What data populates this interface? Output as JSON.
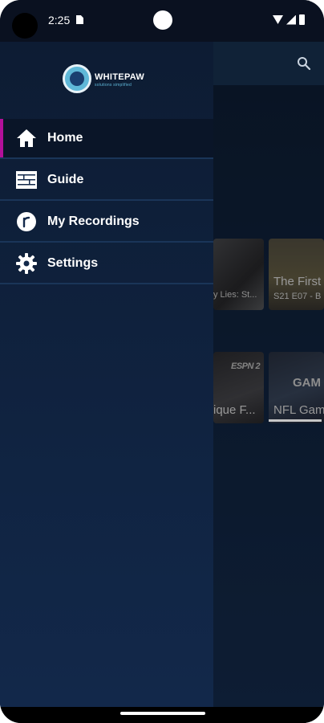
{
  "status_bar": {
    "time": "2:25"
  },
  "brand": {
    "name": "WHITEPAW",
    "tagline": "solutions simplified"
  },
  "drawer": {
    "items": [
      {
        "label": "Home",
        "icon": "home-icon",
        "active": true
      },
      {
        "label": "Guide",
        "icon": "guide-icon",
        "active": false
      },
      {
        "label": "My Recordings",
        "icon": "recordings-icon",
        "active": false
      },
      {
        "label": "Settings",
        "icon": "gear-icon",
        "active": false
      }
    ]
  },
  "background": {
    "row1": [
      {
        "title": "",
        "subtitle": "y Lies: St..."
      },
      {
        "title": "The First",
        "subtitle": "S21 E07 - B"
      }
    ],
    "row2": [
      {
        "title": "ique F...",
        "channel": "ESPN 2"
      },
      {
        "title": "NFL Gam",
        "brand_text": "GAM",
        "progress": 1.0
      }
    ]
  },
  "colors": {
    "accent": "#b3109a",
    "drawer": "#0d1c33",
    "header": "#1a3555"
  }
}
